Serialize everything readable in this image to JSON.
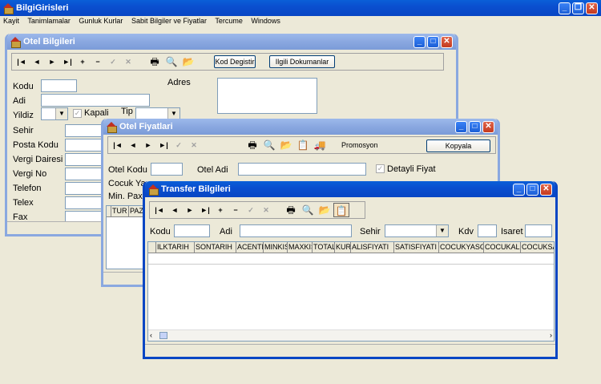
{
  "app": {
    "title": "BilgiGirisleri",
    "menu": [
      "Kayit",
      "Tanimlamalar",
      "Gunluk Kurlar",
      "Sabit Bilgiler ve Fiyatlar",
      "Tercume",
      "Windows"
    ]
  },
  "otel": {
    "title": "Otel Bilgileri",
    "kod_degistir": "Kod Degistir",
    "ilgili": "Ilgili Dokumanlar",
    "kodu": "Kodu",
    "adi": "Adi",
    "yildiz": "Yildiz",
    "kapali": "Kapali",
    "tip": "Tip",
    "adres": "Adres",
    "fields": [
      "Sehir",
      "Posta Kodu",
      "Vergi Dairesi",
      "Vergi No",
      "Telefon",
      "Telex",
      "Fax"
    ]
  },
  "fiyat": {
    "title": "Otel Fiyatlari",
    "promosyon": "Promosyon",
    "kopyala": "Kopyala",
    "otel_kodu": "Otel Kodu",
    "otel_adi": "Otel Adi",
    "detayli": "Detayli Fiyat",
    "cocuk": "Cocuk Ya",
    "minpax": "Min. Pax",
    "cols": [
      "TUR",
      "PAZ"
    ]
  },
  "transfer": {
    "title": "Transfer Bilgileri",
    "kodu": "Kodu",
    "adi": "Adi",
    "sehir": "Sehir",
    "kdv": "Kdv",
    "isaret": "Isaret",
    "cols": [
      "ILKTARIH",
      "SONTARIH",
      "ACENTE",
      "MINKISI",
      "MAXKISI",
      "TOTAL",
      "KUR",
      "ALISFIYATI",
      "SATISFIYATI",
      "COCUKYASGR",
      "COCUKALIS",
      "COCUKSAT"
    ]
  }
}
